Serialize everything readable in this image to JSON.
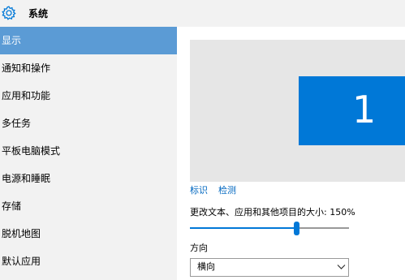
{
  "window": {
    "title": "系统",
    "icon": "gear-icon"
  },
  "sidebar": {
    "items": [
      {
        "label": "显示",
        "active": true
      },
      {
        "label": "通知和操作",
        "active": false
      },
      {
        "label": "应用和功能",
        "active": false
      },
      {
        "label": "多任务",
        "active": false
      },
      {
        "label": "平板电脑模式",
        "active": false
      },
      {
        "label": "电源和睡眠",
        "active": false
      },
      {
        "label": "存储",
        "active": false
      },
      {
        "label": "脱机地图",
        "active": false
      },
      {
        "label": "默认应用",
        "active": false
      }
    ]
  },
  "display": {
    "monitor_number": "1",
    "identify_label": "标识",
    "detect_label": "检测",
    "scale_label": "更改文本、应用和其他项目的大小: 150%",
    "scale_slider_fraction": 0.67,
    "orientation_label": "方向",
    "orientation_value": "横向"
  },
  "colors": {
    "accent": "#0078d7",
    "nav_active": "#5b9bd5",
    "link": "#0067c0",
    "panel_bg": "#f2f2f2",
    "preview_bg": "#e6e6e6"
  }
}
